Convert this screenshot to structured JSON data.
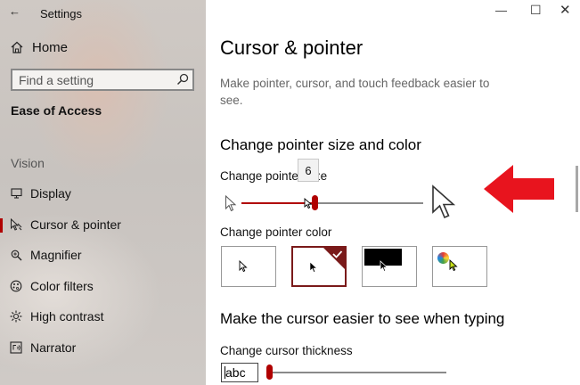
{
  "app": {
    "title": "Settings"
  },
  "sidebar": {
    "home_label": "Home",
    "search_placeholder": "Find a setting",
    "section_title": "Ease of Access",
    "group_label": "Vision",
    "items": [
      {
        "label": "Display",
        "icon": "display-icon"
      },
      {
        "label": "Cursor & pointer",
        "icon": "cursor-pointer-icon",
        "active": true
      },
      {
        "label": "Magnifier",
        "icon": "magnifier-icon"
      },
      {
        "label": "Color filters",
        "icon": "color-filters-icon"
      },
      {
        "label": "High contrast",
        "icon": "high-contrast-icon"
      },
      {
        "label": "Narrator",
        "icon": "narrator-icon"
      }
    ]
  },
  "main": {
    "title": "Cursor & pointer",
    "description": "Make pointer, cursor, and touch feedback easier to see.",
    "pointer_section": {
      "heading": "Change pointer size and color",
      "size_label": "Change pointer size",
      "size_value": "6",
      "size_fraction": 0.4,
      "color_label": "Change pointer color",
      "color_options": [
        "white",
        "black",
        "inverted",
        "custom"
      ],
      "selected_color": "black"
    },
    "typing_section": {
      "heading": "Make the cursor easier to see when typing",
      "thickness_label": "Change cursor thickness",
      "preview_text": "abc",
      "thickness_fraction": 0.0
    }
  },
  "colors": {
    "accent": "#b00000",
    "annotation_arrow": "#e8141e"
  }
}
